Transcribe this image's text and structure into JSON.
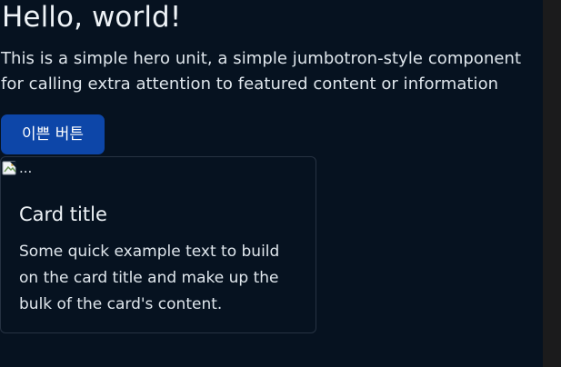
{
  "hero": {
    "title": "Hello, world!",
    "text": "This is a simple hero unit, a simple jumbotron-style component for calling extra attention to featured content or information",
    "button_label": "이쁜 버튼"
  },
  "card": {
    "image_alt": "...",
    "title": "Card title",
    "text": "Some quick example text to build on the card title and make up the bulk of the card's content."
  },
  "icons": {
    "broken_image": "broken-image-icon"
  },
  "colors": {
    "page_background": "#061220",
    "button_background": "#0d46a8",
    "card_border": "#263242",
    "right_rail": "#1b1b1c"
  }
}
